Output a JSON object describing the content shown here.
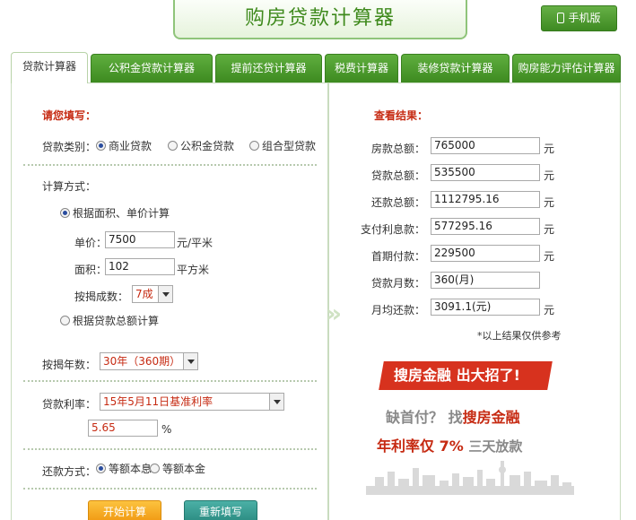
{
  "header": {
    "title": "购房贷款计算器",
    "mobile_button": "手机版"
  },
  "tabs": [
    {
      "label": "贷款计算器",
      "active": true
    },
    {
      "label": "公积金贷款计算器"
    },
    {
      "label": "提前还贷计算器"
    },
    {
      "label": "税费计算器"
    },
    {
      "label": "装修贷款计算器"
    },
    {
      "label": "购房能力评估计算器"
    }
  ],
  "form": {
    "heading": "请您填写：",
    "loan_type_label": "贷款类别：",
    "loan_types": [
      "商业贷款",
      "公积金贷款",
      "组合型贷款"
    ],
    "calc_method_label": "计算方式：",
    "method_area": "根据面积、单价计算",
    "unit_price_label": "单价：",
    "unit_price_value": "7500",
    "unit_price_unit": "元/平米",
    "area_label": "面积：",
    "area_value": "102",
    "area_unit": "平方米",
    "ratio_label": "按揭成数：",
    "ratio_value": "7成",
    "method_total": "根据贷款总额计算",
    "years_label": "按揭年数：",
    "years_value": "30年（360期）",
    "rate_label": "贷款利率：",
    "rate_select": "15年5月11日基准利率",
    "rate_value": "5.65",
    "rate_unit": "%",
    "repay_label": "还款方式：",
    "repay_options": [
      "等额本息",
      "等额本金"
    ],
    "start_button": "开始计算",
    "reset_button": "重新填写"
  },
  "results": {
    "heading": "查看结果：",
    "rows": [
      {
        "label": "房款总额：",
        "value": "765000",
        "unit": "元"
      },
      {
        "label": "贷款总额：",
        "value": "535500",
        "unit": "元"
      },
      {
        "label": "还款总额：",
        "value": "1112795.16",
        "unit": "元"
      },
      {
        "label": "支付利息款：",
        "value": "577295.16",
        "unit": "元"
      },
      {
        "label": "首期付款：",
        "value": "229500",
        "unit": "元"
      },
      {
        "label": "贷款月数：",
        "value": "360(月)",
        "unit": ""
      },
      {
        "label": "月均还款：",
        "value": "3091.1(元)",
        "unit": "元"
      }
    ],
    "note": "*以上结果仅供参考"
  },
  "ad": {
    "banner": "搜房金融   出大招了!",
    "line1_a": "缺首付？",
    "line1_b": "找",
    "line1_c": "搜房金融",
    "line2_a": "年利率仅 7%",
    "line2_b": "三天放款"
  }
}
